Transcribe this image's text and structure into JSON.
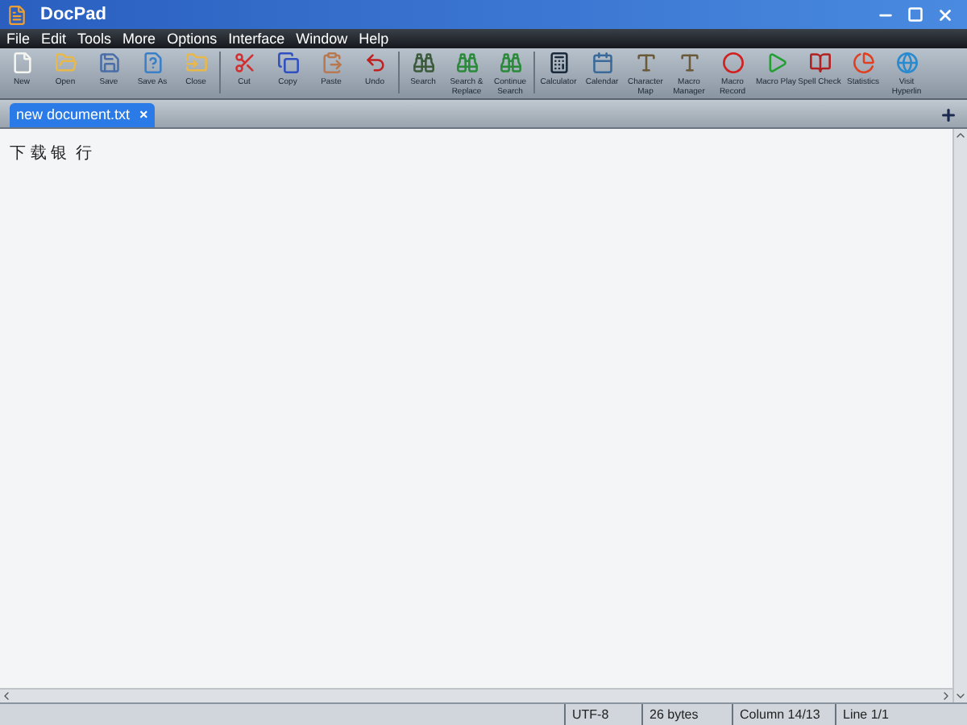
{
  "window": {
    "title": "DocPad"
  },
  "menu": [
    "File",
    "Edit",
    "Tools",
    "More",
    "Options",
    "Interface",
    "Window",
    "Help"
  ],
  "toolbar": [
    {
      "kind": "new",
      "label": "New"
    },
    {
      "kind": "open",
      "label": "Open"
    },
    {
      "kind": "save",
      "label": "Save"
    },
    {
      "kind": "saveas",
      "label": "Save As"
    },
    {
      "kind": "close",
      "label": "Close"
    },
    {
      "kind": "cut",
      "label": "Cut"
    },
    {
      "kind": "copy",
      "label": "Copy"
    },
    {
      "kind": "paste",
      "label": "Paste"
    },
    {
      "kind": "undo",
      "label": "Undo"
    },
    {
      "kind": "search",
      "label": "Search"
    },
    {
      "kind": "replace",
      "label": "Search & Replace"
    },
    {
      "kind": "continue",
      "label": "Continue Search"
    },
    {
      "kind": "calculator",
      "label": "Calculator"
    },
    {
      "kind": "calendar",
      "label": "Calendar"
    },
    {
      "kind": "charmap",
      "label": "Character Map"
    },
    {
      "kind": "macro",
      "label": "Macro Manager"
    },
    {
      "kind": "record",
      "label": "Macro Record"
    },
    {
      "kind": "play",
      "label": "Macro Play"
    },
    {
      "kind": "spell",
      "label": "Spell Check"
    },
    {
      "kind": "stats",
      "label": "Statistics"
    },
    {
      "kind": "link",
      "label": "Visit Hyperlin"
    }
  ],
  "tabs": [
    {
      "label": "new document.txt",
      "close": "×",
      "selected": true
    }
  ],
  "editor": {
    "text": "下 载 银  行"
  },
  "status_bar": [
    "UTF-8",
    "26 bytes",
    "Column 14/13",
    "Line 1/1"
  ]
}
